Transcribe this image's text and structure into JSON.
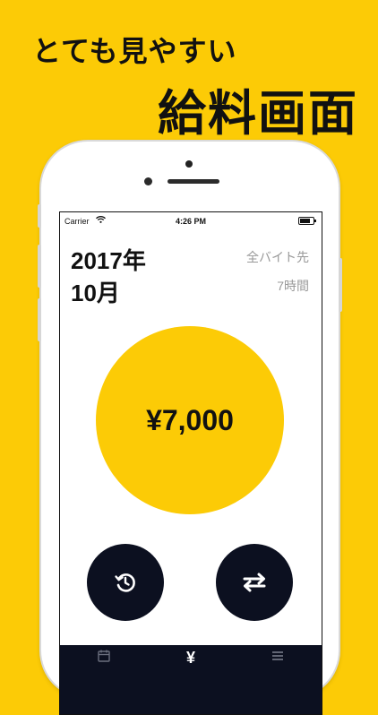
{
  "promo": {
    "line1": "とても見やすい",
    "line2": "給料画面"
  },
  "status_bar": {
    "carrier": "Carrier",
    "time": "4:26 PM"
  },
  "summary": {
    "year": "2017年",
    "month": "10月",
    "workplace": "全バイト先",
    "hours": "7時間",
    "amount": "¥7,000"
  },
  "icons": {
    "left_button": "history-icon",
    "right_button": "swap-arrows-icon",
    "tab_calendar": "calendar-icon",
    "tab_salary": "yen-icon",
    "tab_menu": "menu-icon"
  },
  "tab_bar": {
    "salary_glyph": "¥"
  },
  "colors": {
    "brand_yellow": "#FCCB06",
    "navy": "#0c1020"
  }
}
